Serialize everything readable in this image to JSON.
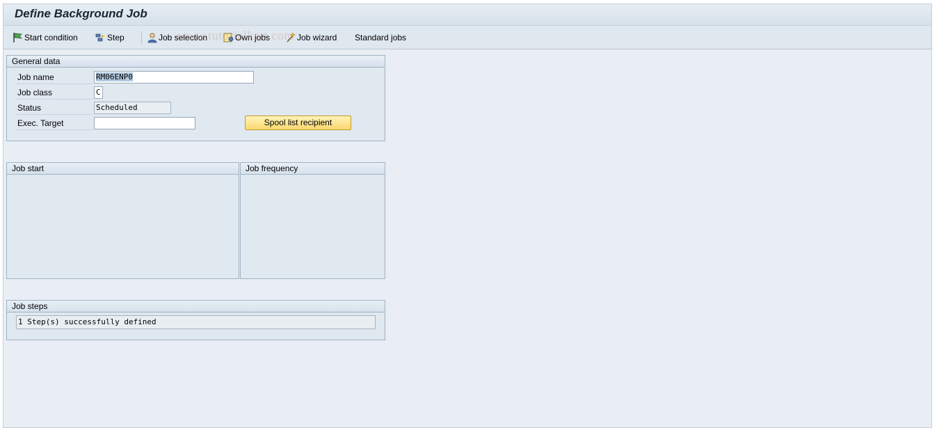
{
  "window": {
    "title": "Define Background Job"
  },
  "toolbar": {
    "items": [
      {
        "label": "Start condition",
        "icon": "flag-icon"
      },
      {
        "label": "Step",
        "icon": "step-icon"
      },
      {
        "label": "Job selection",
        "icon": "person-icon"
      },
      {
        "label": "Own jobs",
        "icon": "own-jobs-icon"
      },
      {
        "label": "Job wizard",
        "icon": "wizard-icon"
      },
      {
        "label": "Standard jobs"
      }
    ]
  },
  "watermark": "www.tutorialkart.com",
  "general_data": {
    "title": "General data",
    "job_name": {
      "label": "Job name",
      "value": "RM06ENP0"
    },
    "job_class": {
      "label": "Job class",
      "value": "C"
    },
    "status": {
      "label": "Status",
      "value": "Scheduled"
    },
    "exec_target": {
      "label": "Exec. Target",
      "value": ""
    },
    "spool_button": "Spool list recipient"
  },
  "job_start": {
    "title": "Job start"
  },
  "job_frequency": {
    "title": "Job frequency"
  },
  "job_steps": {
    "title": "Job steps",
    "message": "1 Step(s) successfully defined"
  },
  "colors": {
    "accent_button": "#fbd86f",
    "background": "#e9eef4",
    "group_border": "#9fb2c4"
  }
}
